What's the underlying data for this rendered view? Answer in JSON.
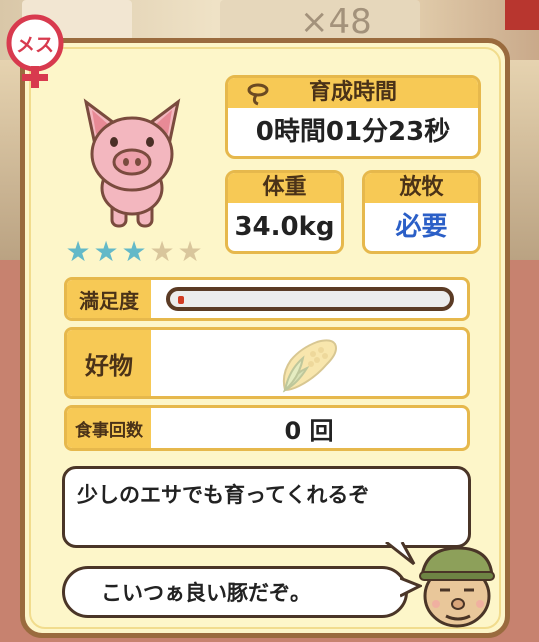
{
  "background": {
    "faint_label": "×48"
  },
  "badge": {
    "sex_label": "メス",
    "icon": "female-symbol-icon"
  },
  "pig": {
    "icon": "pig-icon",
    "rating": {
      "filled": 3,
      "max": 5
    }
  },
  "growth_time": {
    "label": "育成時間",
    "value": "0時間01分23秒",
    "icon": "lasso-icon"
  },
  "weight": {
    "label": "体重",
    "value": "34.0kg"
  },
  "grazing": {
    "label": "放牧",
    "value": "必要"
  },
  "satisfaction": {
    "label": "満足度",
    "level_fraction": 0.02
  },
  "favorite": {
    "label": "好物",
    "item_icon": "corn-icon"
  },
  "meals": {
    "label": "食事回数",
    "value": "0 回"
  },
  "dialogue": {
    "line1": "少しのエサでも育ってくれるぞ",
    "line2": "こいつぁ良い豚だぞ。",
    "speaker_icon": "farmer-icon"
  },
  "colors": {
    "panel_bg": "#fdf6c9",
    "panel_border": "#9a6b3e",
    "label_bg": "#f7c955",
    "star_on": "#63b9c8",
    "grazing_value": "#2b5fc7",
    "gauge_fill": "#d13b22",
    "badge": "#d83a4e"
  }
}
